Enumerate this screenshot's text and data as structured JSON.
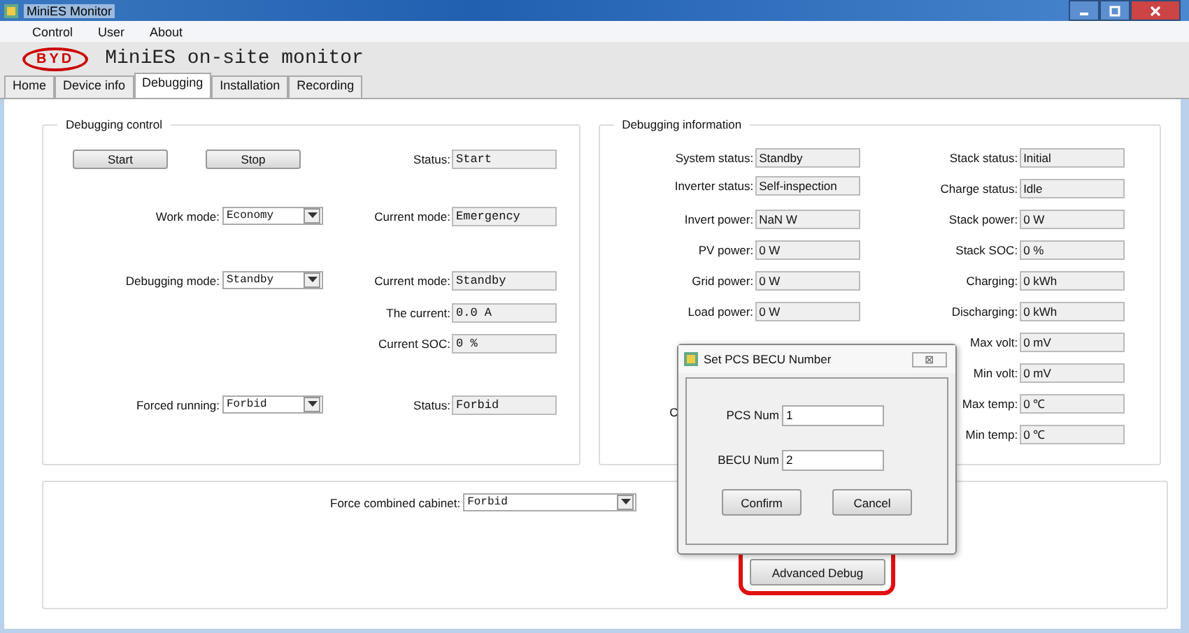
{
  "window": {
    "title": "MiniES Monitor"
  },
  "menu": [
    "Control",
    "User",
    "About"
  ],
  "header": {
    "logo": "BYD",
    "title": "MiniES on-site monitor"
  },
  "tabs": [
    {
      "label": "Home",
      "selected": false
    },
    {
      "label": "Device info",
      "selected": false
    },
    {
      "label": "Debugging",
      "selected": true
    },
    {
      "label": "Installation",
      "selected": false
    },
    {
      "label": "Recording",
      "selected": false
    }
  ],
  "debugging_control": {
    "title": "Debugging control",
    "buttons": [
      "Start",
      "Stop"
    ],
    "rows": [
      {
        "kind": "buttons",
        "status_label": "Status:",
        "status_value": "Start"
      },
      {
        "kind": "combo",
        "label": "Work mode:",
        "value": "Economy",
        "status_label": "Current mode:",
        "status_value": "Emergency"
      },
      {
        "kind": "combo",
        "label": "Debugging mode:",
        "value": "Standby",
        "status_label": "Current mode:",
        "status_value": "Standby"
      },
      {
        "kind": "plain",
        "status_label": "The current:",
        "status_value": "0.0 A"
      },
      {
        "kind": "plain",
        "status_label": "Current SOC:",
        "status_value": "0 %"
      },
      {
        "kind": "combo",
        "label": "Forced running:",
        "value": "Forbid",
        "status_label": "Status:",
        "status_value": "Forbid"
      }
    ]
  },
  "debugging_information": {
    "title": "Debugging information",
    "left": [
      {
        "label": "System status:",
        "value": "Standby"
      },
      {
        "label": "Inverter status:",
        "value": "Self-inspection"
      },
      {
        "label": "Invert power:",
        "value": "NaN W"
      },
      {
        "label": "PV power:",
        "value": "0 W"
      },
      {
        "label": "Grid power:",
        "value": "0 W"
      },
      {
        "label": "Load power:",
        "value": "0 W"
      }
    ],
    "hidden_label": "C",
    "right": [
      {
        "label": "Stack status:",
        "value": "Initial"
      },
      {
        "label": "Charge status:",
        "value": "Idle"
      },
      {
        "label": "Stack power:",
        "value": "0 W"
      },
      {
        "label": "Stack SOC:",
        "value": "0 %"
      },
      {
        "label": "Charging:",
        "value": "0 kWh"
      },
      {
        "label": "Discharging:",
        "value": "0 kWh"
      },
      {
        "label": "Max volt:",
        "value": "0 mV"
      },
      {
        "label": "Min volt:",
        "value": "0 mV"
      },
      {
        "label": "Max temp:",
        "value": "0 ℃"
      },
      {
        "label": "Min temp:",
        "value": "0 ℃"
      }
    ]
  },
  "bottom": {
    "label": "Force combined cabinet:",
    "value": "Forbid",
    "button": "Advanced Debug",
    "button_highlighted": true
  },
  "dialog": {
    "title": "Set PCS BECU Number",
    "close": "⊠",
    "fields": [
      {
        "label": "PCS Num",
        "value": "1"
      },
      {
        "label": "BECU Num",
        "value": "2"
      }
    ],
    "buttons": [
      "Confirm",
      "Cancel"
    ]
  }
}
